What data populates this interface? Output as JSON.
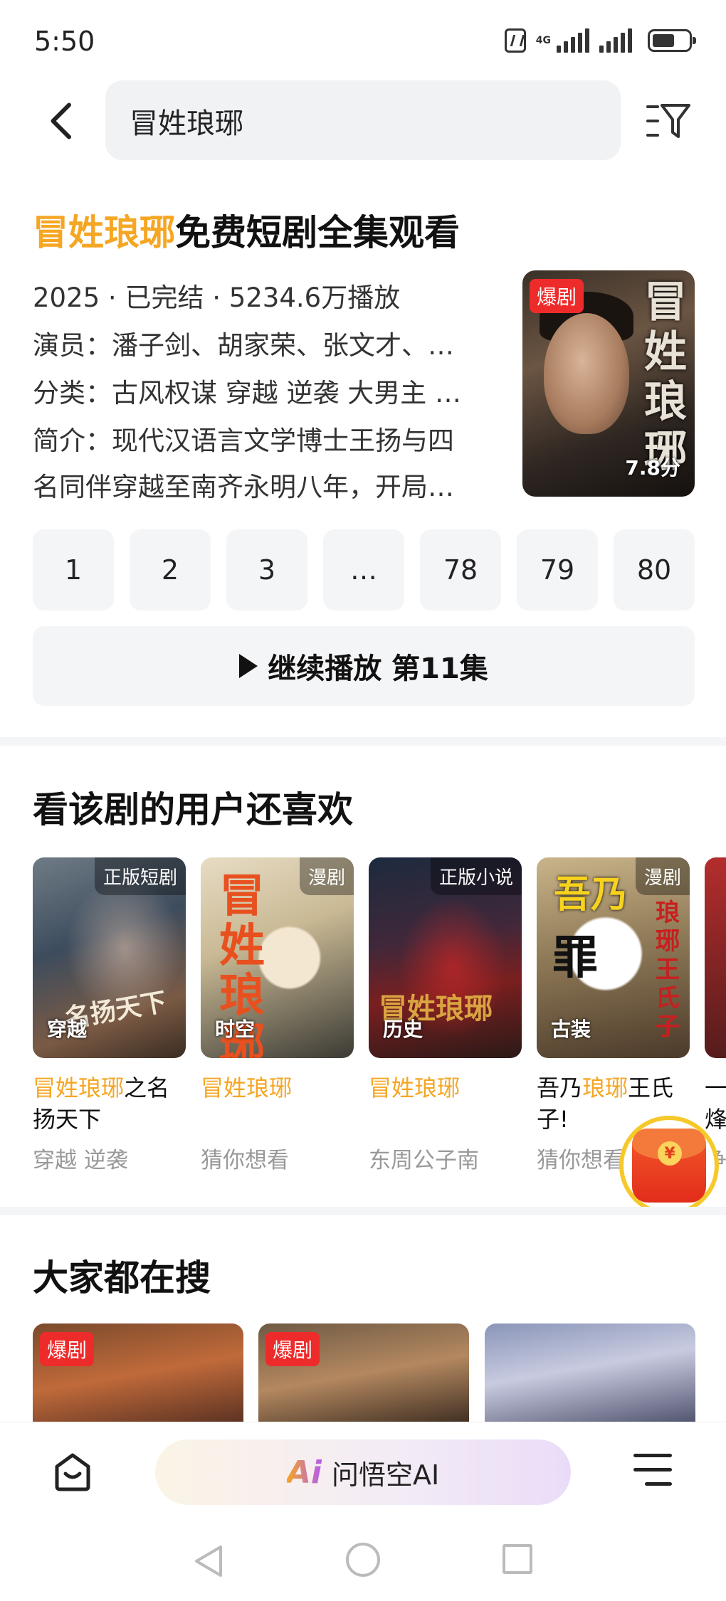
{
  "status_bar": {
    "time": "5:50",
    "network": "4G"
  },
  "search": {
    "query": "冒姓琅琊"
  },
  "result": {
    "title_highlight": "冒姓琅琊",
    "title_rest": "免费短剧全集观看",
    "meta_line": "2025 · 已完结 · 5234.6万播放",
    "cast_line": "演员：潘子剑、胡家荣、张文才、…",
    "category_line": "分类：古风权谋 穿越 逆袭 大男主 …",
    "intro_line1": "简介：现代汉语言文学博士王扬与四",
    "intro_line2": "名同伴穿越至南齐永明八年，开局…",
    "poster_badge": "爆剧",
    "poster_title": "冒姓琅琊",
    "poster_score": "7.8分",
    "episodes": [
      "1",
      "2",
      "3",
      "…",
      "78",
      "79",
      "80"
    ],
    "continue_label": "继续播放 第11集"
  },
  "also_like": {
    "title": "看该剧的用户还喜欢",
    "items": [
      {
        "tag": "正版短剧",
        "genre": "穿越",
        "title_highlight": "冒姓琅琊",
        "title_rest": "之名扬天下",
        "subtitle": "穿越 逆袭"
      },
      {
        "tag": "漫剧",
        "genre": "时空",
        "title_highlight": "冒姓琅琊",
        "title_rest": "",
        "subtitle": "猜你想看"
      },
      {
        "tag": "正版小说",
        "genre": "历史",
        "title_highlight": "冒姓琅琊",
        "title_rest": "",
        "subtitle": "东周公子南"
      },
      {
        "tag": "漫剧",
        "genre": "古装",
        "title_prefix": "吾乃",
        "title_highlight": "琅琊",
        "title_rest": "王氏子!",
        "subtitle": "猜你想看"
      },
      {
        "title_prefix": "一",
        "title_rest": "烽",
        "subtitle": "争"
      }
    ]
  },
  "trending": {
    "title": "大家都在搜",
    "items": [
      {
        "badge": "爆剧"
      },
      {
        "badge": "爆剧"
      },
      {
        "badge": ""
      }
    ]
  },
  "bottom_bar": {
    "ai_logo": "Ai",
    "ai_label": "问悟空AI"
  },
  "colors": {
    "highlight": "#f5a623",
    "badge_red": "#ee2b2b",
    "ai_gradient_start": "#f5a623",
    "ai_gradient_end": "#b45cf0"
  }
}
